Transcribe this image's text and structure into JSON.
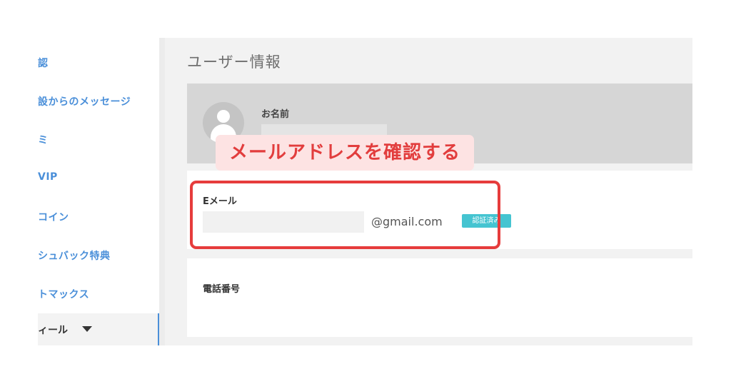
{
  "sidebar": {
    "items": [
      {
        "label": "認"
      },
      {
        "label": "設からのメッセージ"
      },
      {
        "label": "ミ"
      },
      {
        "label": "VIP"
      },
      {
        "label": "コイン"
      },
      {
        "label": "シュバック特典"
      },
      {
        "label": "トマックス"
      }
    ],
    "active_item": {
      "label": "ィール",
      "icon": "caret-down-icon"
    }
  },
  "main": {
    "title": "ユーザー情報",
    "name_section": {
      "label": "お名前",
      "avatar_icon": "user-avatar-icon"
    },
    "email_section": {
      "label": "Eメール",
      "value_suffix": "@gmail.com",
      "badge": "認証済み"
    },
    "phone_section": {
      "label": "電話番号"
    }
  },
  "annotation": {
    "callout_text": "メールアドレスを確認する"
  },
  "colors": {
    "accent_link": "#4a8fd9",
    "verified_badge": "#45c4d1",
    "annotation_red": "#e63c3c",
    "callout_bg": "#fde3e3"
  }
}
